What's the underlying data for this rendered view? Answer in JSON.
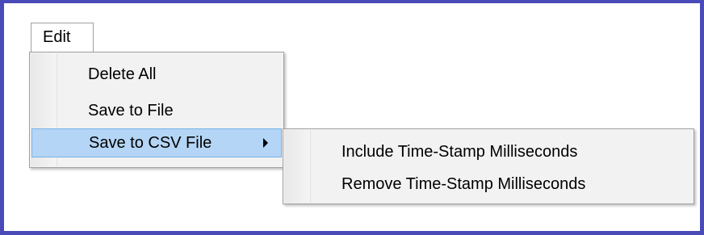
{
  "menubar": {
    "edit_label": "Edit"
  },
  "edit_menu": {
    "items": [
      {
        "label": "Delete All"
      },
      {
        "label": "Save to File"
      },
      {
        "label": "Save to CSV File",
        "has_submenu": true,
        "highlighted": true
      }
    ]
  },
  "csv_submenu": {
    "items": [
      {
        "label": "Include Time-Stamp Milliseconds"
      },
      {
        "label": "Remove Time-Stamp Milliseconds"
      }
    ]
  },
  "colors": {
    "frame_border": "#4a4ab8",
    "highlight_fill": "#b4d5f5",
    "highlight_border": "#78b4e6",
    "menu_background": "#f2f2f2"
  },
  "icons": {
    "submenu_indicator": "chevron-right-icon"
  }
}
